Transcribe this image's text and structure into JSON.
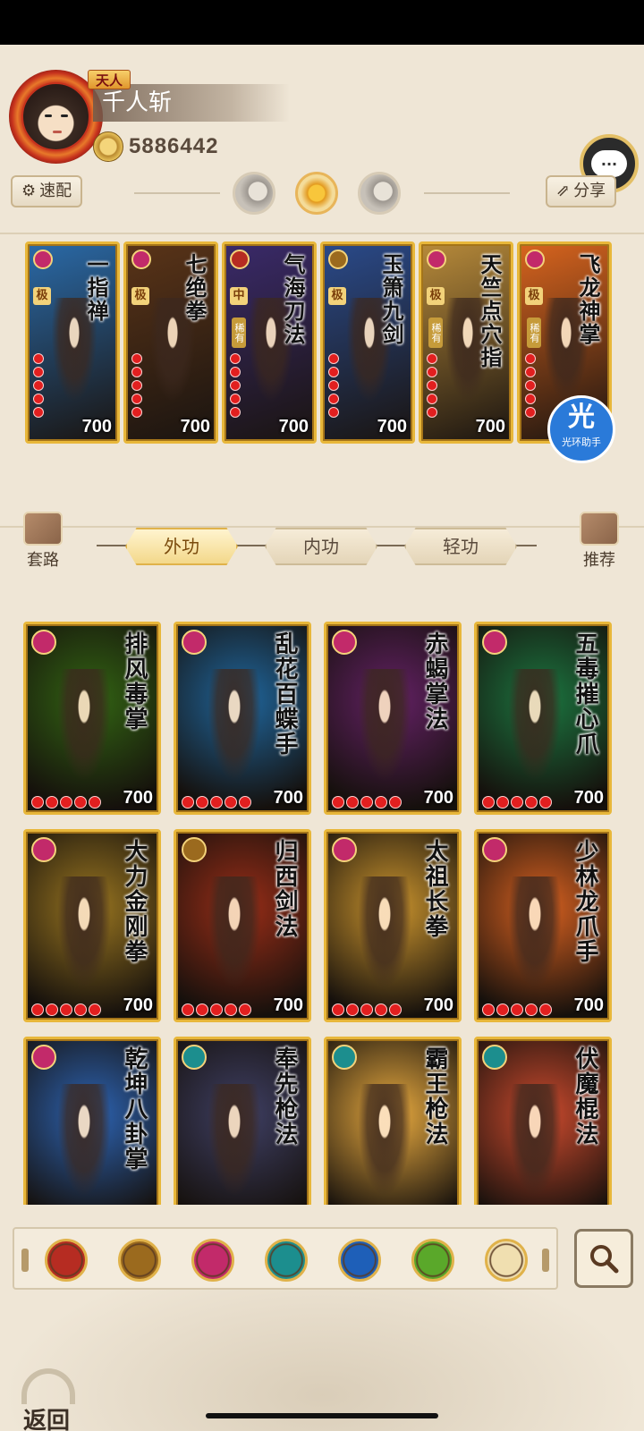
{
  "player": {
    "rank": "天人",
    "name": "千人斩",
    "coins": "5886442"
  },
  "header": {
    "quick_assign_label": "速配",
    "share_label": "分享"
  },
  "equipped_skills": [
    {
      "name": "一指禅",
      "grade": "极",
      "rarity": "",
      "value": "700",
      "school": "pink"
    },
    {
      "name": "七绝拳",
      "grade": "极",
      "rarity": "",
      "value": "700",
      "school": "pink"
    },
    {
      "name": "气海刀法",
      "grade": "中",
      "rarity": "稀有",
      "value": "700",
      "school": "red"
    },
    {
      "name": "玉箫九剑",
      "grade": "极",
      "rarity": "",
      "value": "700",
      "school": "gold"
    },
    {
      "name": "天竺点穴指",
      "grade": "极",
      "rarity": "稀有",
      "value": "700",
      "school": "pink"
    },
    {
      "name": "飞龙神掌",
      "grade": "极",
      "rarity": "稀有",
      "value": "",
      "school": "pink"
    }
  ],
  "helper_badge": {
    "main": "光",
    "sub": "光环助手"
  },
  "tabs": {
    "left_label": "套路",
    "right_label": "推荐",
    "items": [
      "外功",
      "内功",
      "轻功"
    ],
    "active": "外功"
  },
  "skills": [
    {
      "name": "排风毒掌",
      "value": "700",
      "school": "pink",
      "bg": "#2f5a12"
    },
    {
      "name": "乱花百蝶手",
      "value": "700",
      "school": "pink",
      "bg": "#1e5c8c"
    },
    {
      "name": "赤蝎掌法",
      "value": "700",
      "school": "pink",
      "bg": "#5a1f5a"
    },
    {
      "name": "五毒摧心爪",
      "value": "700",
      "school": "pink",
      "bg": "#1b6a3a"
    },
    {
      "name": "大力金刚拳",
      "value": "700",
      "school": "pink",
      "bg": "#8a6a1e"
    },
    {
      "name": "归西剑法",
      "value": "700",
      "school": "gold",
      "bg": "#8a2a16"
    },
    {
      "name": "太祖长拳",
      "value": "700",
      "school": "pink",
      "bg": "#b7862a"
    },
    {
      "name": "少林龙爪手",
      "value": "700",
      "school": "pink",
      "bg": "#c2581e"
    },
    {
      "name": "乾坤八卦掌",
      "value": "",
      "school": "pink",
      "bg": "#2a5aa0"
    },
    {
      "name": "奉先枪法",
      "value": "",
      "school": "green",
      "bg": "#3a3a5a"
    },
    {
      "name": "霸王枪法",
      "value": "",
      "school": "green",
      "bg": "#d29a3a"
    },
    {
      "name": "伏魔棍法",
      "value": "",
      "school": "green",
      "bg": "#b8442a"
    }
  ],
  "filters": [
    {
      "icon": "blade-school-icon",
      "color": "#b62c22"
    },
    {
      "icon": "sword-school-icon",
      "color": "#9b6a1e"
    },
    {
      "icon": "palm-school-icon",
      "color": "#c22a6a"
    },
    {
      "icon": "fan-school-icon",
      "color": "#1c8e8e"
    },
    {
      "icon": "taiji-school-icon",
      "color": "#1e5fb8"
    },
    {
      "icon": "hand-school-icon",
      "color": "#5aa82a"
    },
    {
      "icon": "triangle-all-icon",
      "color": "#f0dfb0"
    }
  ],
  "back_label": "返回"
}
